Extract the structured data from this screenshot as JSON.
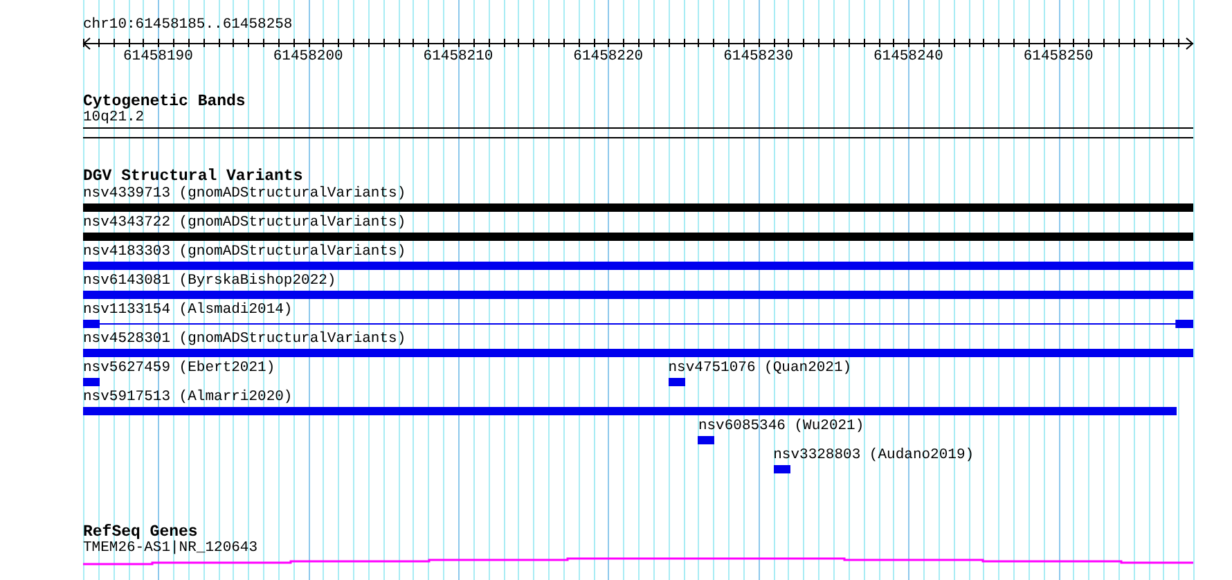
{
  "location": "chr10:61458185..61458258",
  "ruler": {
    "labels": [
      "61458190",
      "61458200",
      "61458210",
      "61458220",
      "61458230",
      "61458240",
      "61458250"
    ]
  },
  "tracks": [
    {
      "kind": "bands",
      "title": "Cytogenetic Bands",
      "features": [
        {
          "label": "10q21.2"
        }
      ]
    },
    {
      "kind": "variants",
      "title": "DGV Structural Variants",
      "features": [
        {
          "label": "nsv4339713 (gnomADStructuralVariants)",
          "color": "#000000",
          "kind": "block"
        },
        {
          "label": "nsv4343722 (gnomADStructuralVariants)",
          "color": "#000000",
          "kind": "block"
        },
        {
          "label": "nsv4183303 (gnomADStructuralVariants)",
          "color": "#0000ee",
          "kind": "block"
        },
        {
          "label": "nsv6143081 (ByrskaBishop2022)",
          "color": "#0000ee",
          "kind": "block"
        },
        {
          "label": "nsv1133154 (Alsmadi2014)",
          "color": "#0000ee",
          "kind": "gapped"
        },
        {
          "label": "nsv4528301 (gnomADStructuralVariants)",
          "color": "#0000ee",
          "kind": "block"
        },
        {
          "label": "nsv5627459 (Ebert2021)",
          "color": "#0000ee",
          "kind": "block"
        },
        {
          "label": "nsv4751076 (Quan2021)",
          "color": "#0000ee",
          "kind": "block"
        },
        {
          "label": "nsv5917513 (Almarri2020)",
          "color": "#0000ee",
          "kind": "block"
        },
        {
          "label": "nsv6085346 (Wu2021)",
          "color": "#0000ee",
          "kind": "block"
        },
        {
          "label": "nsv3328803 (Audano2019)",
          "color": "#0000ee",
          "kind": "block"
        }
      ]
    },
    {
      "kind": "genes",
      "title": "RefSeq Genes",
      "features": [
        {
          "label": "TMEM26-AS1|NR_120643"
        }
      ]
    }
  ]
}
